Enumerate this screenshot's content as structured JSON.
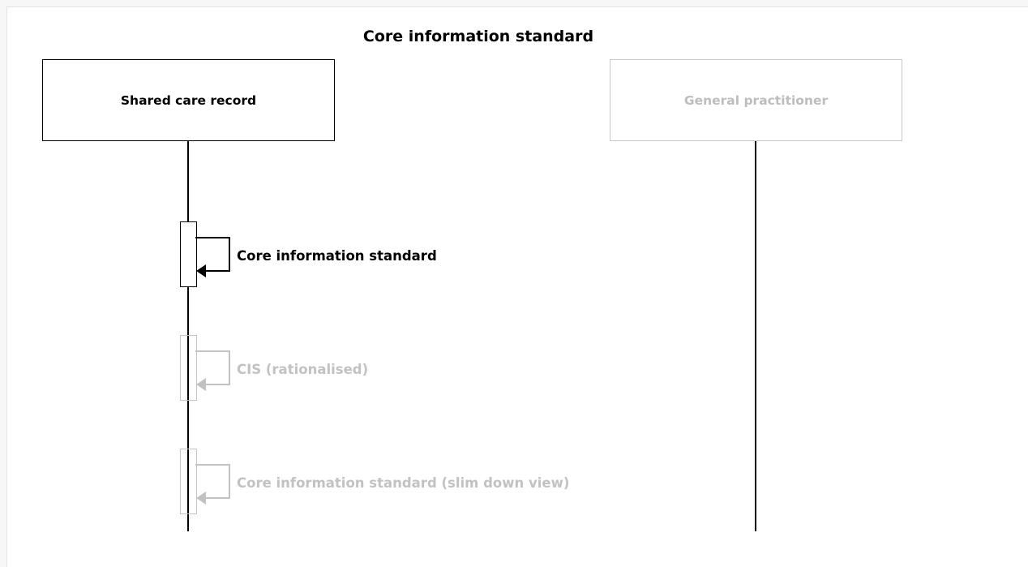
{
  "title": "Core information standard",
  "participants": [
    {
      "label": "Shared care record",
      "state": "active"
    },
    {
      "label": "General practitioner",
      "state": "faded"
    }
  ],
  "messages": [
    {
      "label": "Core information standard",
      "state": "active"
    },
    {
      "label": "CIS (rationalised)",
      "state": "faded"
    },
    {
      "label": "Core information standard (slim down view)",
      "state": "faded"
    }
  ],
  "colors": {
    "active": "#000000",
    "faded": "#c2c2c2"
  }
}
